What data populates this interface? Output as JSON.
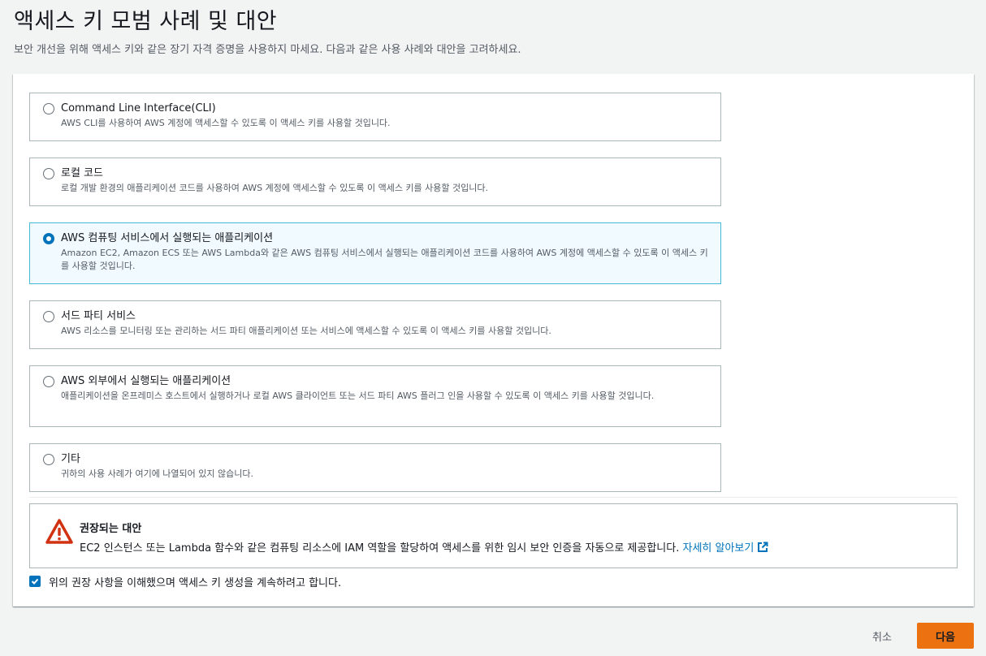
{
  "header": {
    "title": "액세스 키 모범 사례 및 대안",
    "description": "보안 개선을 위해 액세스 키와 같은 장기 자격 증명을 사용하지 마세요. 다음과 같은 사용 사례와 대안을 고려하세요."
  },
  "options": [
    {
      "label": "Command Line Interface(CLI)",
      "description": "AWS CLI를 사용하여 AWS 계정에 액세스할 수 있도록 이 액세스 키를 사용할 것입니다.",
      "selected": false
    },
    {
      "label": "로컬 코드",
      "description": "로컬 개발 환경의 애플리케이션 코드를 사용하여 AWS 계정에 액세스할 수 있도록 이 액세스 키를 사용할 것입니다.",
      "selected": false
    },
    {
      "label": "AWS 컴퓨팅 서비스에서 실행되는 애플리케이션",
      "description": "Amazon EC2, Amazon ECS 또는 AWS Lambda와 같은 AWS 컴퓨팅 서비스에서 실행되는 애플리케이션 코드를 사용하여 AWS 계정에 액세스할 수 있도록 이 액세스 키를 사용할 것입니다.",
      "selected": true
    },
    {
      "label": "서드 파티 서비스",
      "description": "AWS 리소스를 모니터링 또는 관리하는 서드 파티 애플리케이션 또는 서비스에 액세스할 수 있도록 이 액세스 키를 사용할 것입니다.",
      "selected": false
    },
    {
      "label": "AWS 외부에서 실행되는 애플리케이션",
      "description": "애플리케이션을 온프레미스 호스트에서 실행하거나 로컬 AWS 클라이언트 또는 서드 파티 AWS 플러그 인을 사용할 수 있도록 이 액세스 키를 사용할 것입니다.",
      "selected": false
    },
    {
      "label": "기타",
      "description": "귀하의 사용 사례가 여기에 나열되어 있지 않습니다.",
      "selected": false
    }
  ],
  "alert": {
    "icon": "warning-icon",
    "title": "권장되는 대안",
    "body": "EC2 인스턴스 또는 Lambda 함수와 같은 컴퓨팅 리소스에 IAM 역할을 할당하여 액세스를 위한 임시 보안 인증을 자동으로 제공합니다.",
    "link_label": "자세히 알아보기"
  },
  "acknowledge": {
    "label": "위의 권장 사항을 이해했으며 액세스 키 생성을 계속하려고 합니다.",
    "checked": true
  },
  "footer": {
    "cancel_label": "취소",
    "next_label": "다음"
  },
  "colors": {
    "accent": "#0073bb",
    "primary_button": "#ec7211",
    "warning": "#d13212",
    "selected_border": "#44b9d6",
    "selected_bg": "#f1faff"
  }
}
